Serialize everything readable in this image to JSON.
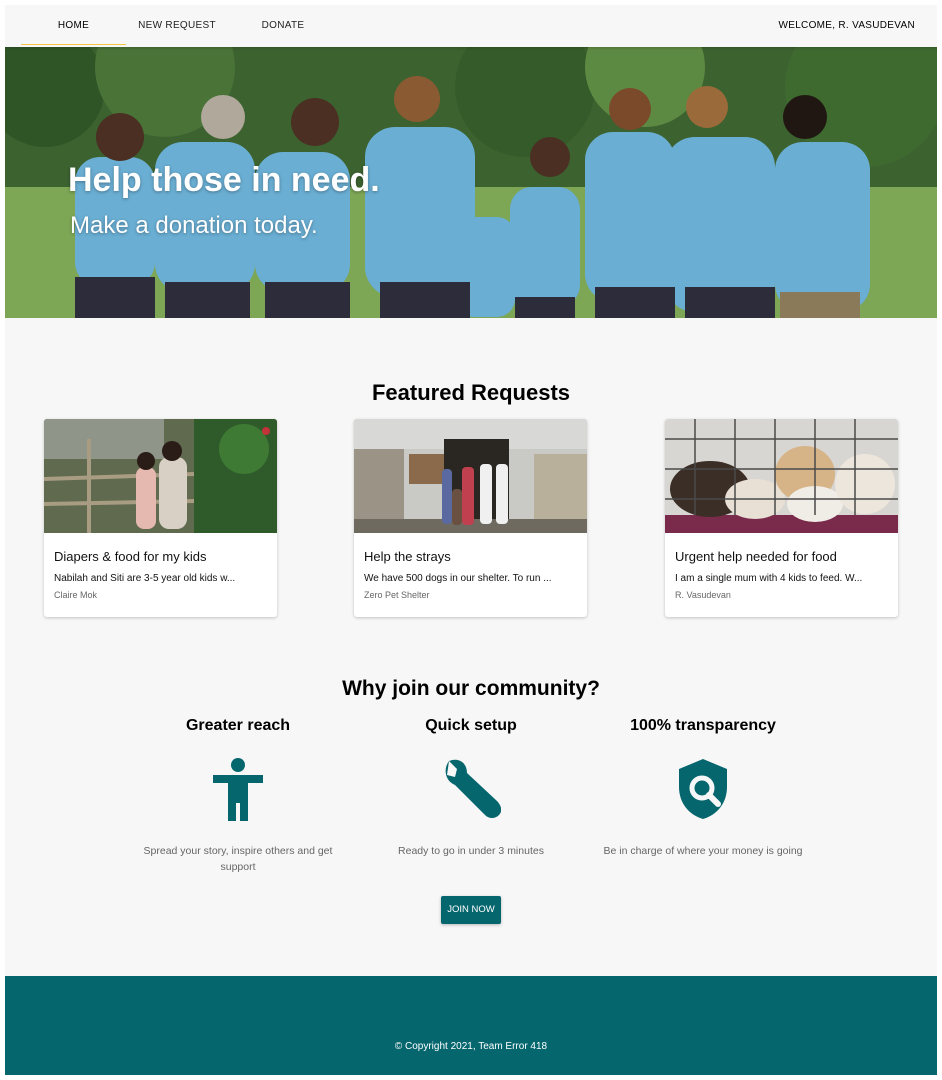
{
  "nav": {
    "items": [
      {
        "label": "HOME",
        "active": true
      },
      {
        "label": "NEW REQUEST",
        "active": false
      },
      {
        "label": "DONATE",
        "active": false
      }
    ],
    "welcome": "WELCOME, R. VASUDEVAN",
    "active_underline_color": "#f4c542"
  },
  "hero": {
    "title": "Help those in need.",
    "subtitle": "Make a donation today."
  },
  "featured": {
    "title": "Featured Requests",
    "cards": [
      {
        "title": "Diapers & food for my kids",
        "description": "Nabilah and Siti are 3-5 year old kids w...",
        "author": "Claire Mok"
      },
      {
        "title": "Help the strays",
        "description": "We have 500 dogs in our shelter. To run ...",
        "author": "Zero Pet Shelter"
      },
      {
        "title": "Urgent help needed for food",
        "description": "I am a single mum with 4 kids to feed. W...",
        "author": "R. Vasudevan"
      }
    ]
  },
  "why": {
    "title": "Why join our community?",
    "features": [
      {
        "heading": "Greater reach",
        "icon": "accessibility-person-icon",
        "text": "Spread your story, inspire others and get support"
      },
      {
        "heading": "Quick setup",
        "icon": "wrench-icon",
        "text": "Ready to go in under 3 minutes"
      },
      {
        "heading": "100% transparency",
        "icon": "shield-search-icon",
        "text": "Be in charge of where your money is going"
      }
    ],
    "join_label": "JOIN NOW"
  },
  "footer": {
    "copyright": "© Copyright 2021, Team Error 418"
  },
  "colors": {
    "brand": "#05666e",
    "background": "#f7f7f7"
  }
}
